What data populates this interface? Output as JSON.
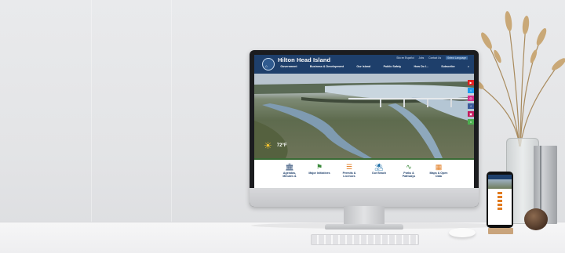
{
  "site": {
    "title": "Hilton Head Island",
    "utility_links": [
      "Sito en Español",
      "Jobs",
      "Contact Us",
      "Select Language"
    ],
    "nav": [
      "Government",
      "Business & Development",
      "Our Island",
      "Public Safety",
      "How Do I...",
      "Subscribe"
    ],
    "weather": {
      "temp": "72°F"
    },
    "quick_links": [
      {
        "label": "Agendas, Minutes &",
        "icon": "building-icon",
        "color": "#1e3f6b"
      },
      {
        "label": "Major Initiatives",
        "icon": "people-icon",
        "color": "#3a8a3a"
      },
      {
        "label": "Permits & Licenses",
        "icon": "list-icon",
        "color": "#e17a1e"
      },
      {
        "label": "Our Beach",
        "icon": "palm-tree-icon",
        "color": "#1e6fa8"
      },
      {
        "label": "Parks & Pathways",
        "icon": "path-icon",
        "color": "#3a8a3a"
      },
      {
        "label": "Maps & Open Data",
        "icon": "map-icon",
        "color": "#e17a1e"
      }
    ],
    "social": [
      {
        "icon": "youtube-icon",
        "color": "#e02020"
      },
      {
        "icon": "twitter-icon",
        "color": "#1d9bf0"
      },
      {
        "icon": "instagram-icon",
        "color": "#d42e8a"
      },
      {
        "icon": "facebook-icon",
        "color": "#3b5a9a"
      },
      {
        "icon": "photo-icon",
        "color": "#c2185b"
      },
      {
        "icon": "nextdoor-icon",
        "color": "#4caf50"
      }
    ]
  }
}
